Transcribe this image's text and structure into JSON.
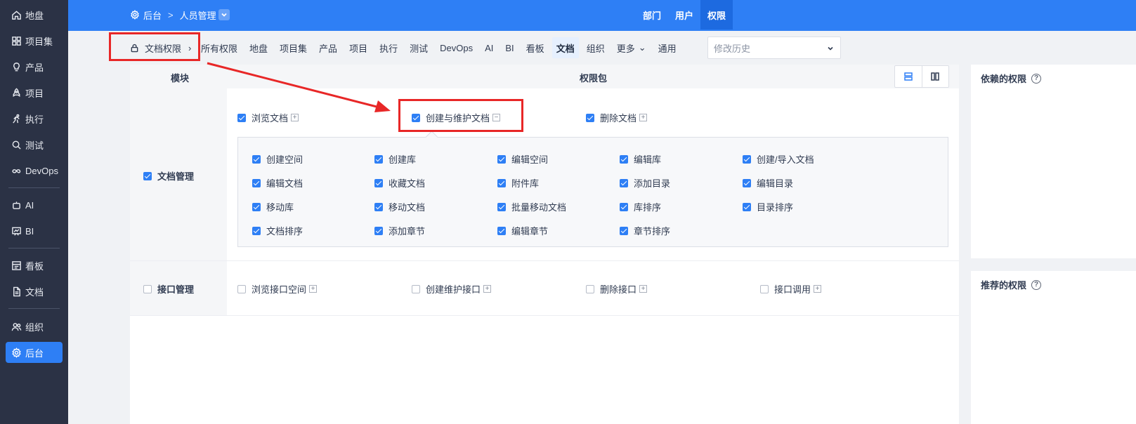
{
  "sidebar": {
    "items": [
      {
        "label": "地盘",
        "icon": "home-icon"
      },
      {
        "label": "项目集",
        "icon": "grid-icon"
      },
      {
        "label": "产品",
        "icon": "bulb-icon"
      },
      {
        "label": "项目",
        "icon": "rocket-icon"
      },
      {
        "label": "执行",
        "icon": "run-icon"
      },
      {
        "label": "测试",
        "icon": "search-bug-icon"
      },
      {
        "label": "DevOps",
        "icon": "infinity-icon"
      },
      {
        "label": "AI",
        "icon": "robot-icon"
      },
      {
        "label": "BI",
        "icon": "chart-board-icon"
      },
      {
        "label": "看板",
        "icon": "kanban-icon"
      },
      {
        "label": "文档",
        "icon": "document-icon"
      },
      {
        "label": "组织",
        "icon": "people-icon"
      },
      {
        "label": "后台",
        "icon": "gear-icon",
        "active": true
      }
    ]
  },
  "header": {
    "breadcrumb_root": "后台",
    "breadcrumb_sep": ">",
    "breadcrumb_current": "人员管理",
    "nav": [
      {
        "label": "部门"
      },
      {
        "label": "用户"
      },
      {
        "label": "权限",
        "active": true
      }
    ]
  },
  "toolbar": {
    "lock_label": "文档权限",
    "lock_chevron": "›",
    "tabs": [
      "所有权限",
      "地盘",
      "项目集",
      "产品",
      "项目",
      "执行",
      "测试",
      "DevOps",
      "AI",
      "BI",
      "看板",
      "文档",
      "组织",
      "更多",
      "通用"
    ],
    "active_tab": "文档",
    "more_caret": "⌄",
    "history_placeholder": "修改历史"
  },
  "table": {
    "col_module": "模块",
    "col_package": "权限包",
    "modules": [
      {
        "name": "文档管理",
        "checked": true,
        "packages": [
          {
            "label": "浏览文档",
            "checked": true,
            "toggle": "+"
          },
          {
            "label": "创建与维护文档",
            "checked": true,
            "toggle": "−",
            "expanded": true
          },
          {
            "label": "删除文档",
            "checked": true,
            "toggle": "+"
          }
        ],
        "sub_permissions": [
          "创建空间",
          "创建库",
          "编辑空间",
          "编辑库",
          "创建/导入文档",
          "编辑文档",
          "收藏文档",
          "附件库",
          "添加目录",
          "编辑目录",
          "移动库",
          "移动文档",
          "批量移动文档",
          "库排序",
          "目录排序",
          "文档排序",
          "添加章节",
          "编辑章节",
          "章节排序"
        ]
      },
      {
        "name": "接口管理",
        "checked": false,
        "packages": [
          {
            "label": "浏览接口空间",
            "checked": false,
            "toggle": "+"
          },
          {
            "label": "创建维护接口",
            "checked": false,
            "toggle": "+"
          },
          {
            "label": "删除接口",
            "checked": false,
            "toggle": "+"
          },
          {
            "label": "接口调用",
            "checked": false,
            "toggle": "+"
          }
        ]
      }
    ]
  },
  "right_panels": {
    "depends_title": "依赖的权限",
    "recommend_title": "推荐的权限",
    "help_glyph": "?"
  },
  "colors": {
    "accent": "#2e7ff5",
    "sidebar_bg": "#2b3245",
    "annotation_red": "#e82727"
  }
}
